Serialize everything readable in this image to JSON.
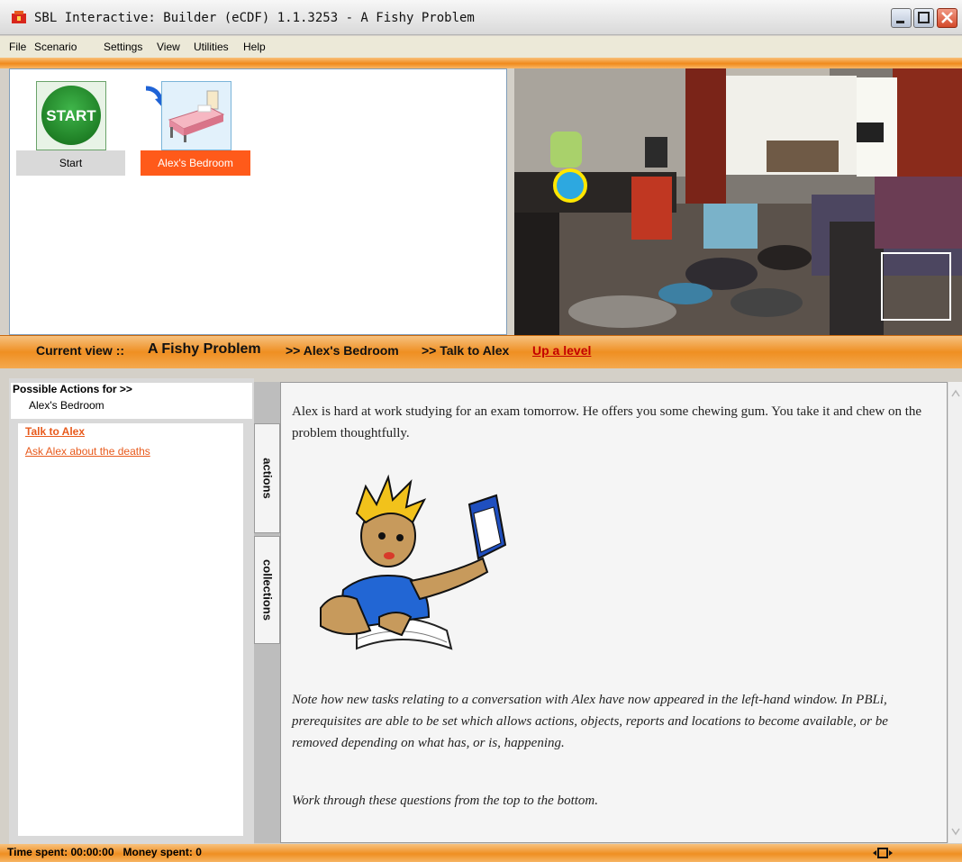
{
  "window": {
    "title": "SBL Interactive: Builder (eCDF) 1.1.3253 - A Fishy Problem"
  },
  "menu": [
    "File",
    "Scenario",
    "Settings",
    "View",
    "Utilities",
    "Help"
  ],
  "flow": {
    "nodes": [
      {
        "label": "Start",
        "icon_text": "START",
        "icon": "start-icon"
      },
      {
        "label": "Alex's Bedroom",
        "icon": "bed-icon",
        "selected": true
      }
    ]
  },
  "view_bar": {
    "prefix": "Current view ::",
    "scenario": "A Fishy Problem",
    "crumb1": ">> Alex's Bedroom",
    "crumb2": ">> Talk to Alex",
    "up_link": "Up a level"
  },
  "left_panel": {
    "header": "Possible Actions for >>",
    "location": "Alex's Bedroom",
    "actions": [
      "Talk to Alex",
      "Ask Alex about the deaths"
    ]
  },
  "tabs": [
    "actions",
    "collections"
  ],
  "content": {
    "intro": "Alex is hard at work studying for an exam tomorrow.  He offers you some chewing gum.  You take it and chew on the problem thoughtfully.",
    "note": "Note how new tasks relating to a conversation with Alex have now appeared in the left-hand window.  In PBLi, prerequisites are able to be set which allows actions, objects, reports and locations to become available, or be removed depending on what has, or is, happening.",
    "instruction": "Work through these questions from the top to the bottom."
  },
  "status": {
    "time_label": "Time spent:",
    "time_value": "00:00:00",
    "money_label": "Money spent:",
    "money_value": "0"
  },
  "colors": {
    "accent": "#f08a1c",
    "selected_node": "#ff5a1a",
    "link": "#e85a1c"
  }
}
